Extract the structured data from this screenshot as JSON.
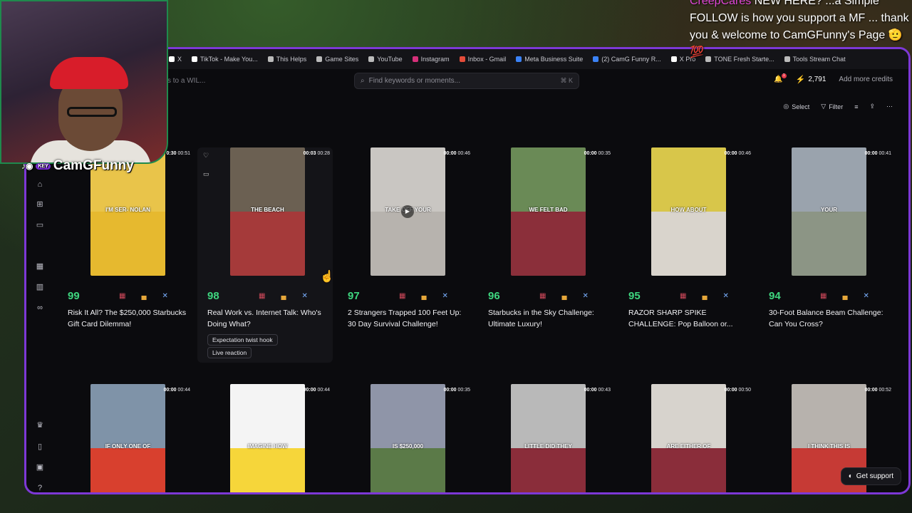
{
  "chat": {
    "username": "CreepCares",
    "message": "NEW HERE? ...a Simple FOLLOW is how you support a MF ... thank you & welcome to CamGFunny's Page 🫡💯"
  },
  "webcam": {
    "streamer_name": "CamGFunny",
    "badge": "KEY"
  },
  "bookmarks": [
    {
      "label": "X",
      "icon": "x-icon",
      "color": "#ffffff"
    },
    {
      "label": "TikTok - Make You...",
      "icon": "tiktok-icon",
      "color": "#ffffff"
    },
    {
      "label": "This Helps",
      "icon": "folder-icon",
      "color": "#bbbbbb"
    },
    {
      "label": "Game Sites",
      "icon": "folder-icon",
      "color": "#bbbbbb"
    },
    {
      "label": "YouTube",
      "icon": "folder-icon",
      "color": "#bbbbbb"
    },
    {
      "label": "Instagram",
      "icon": "instagram-icon",
      "color": "#d6307a"
    },
    {
      "label": "Inbox - Gmail",
      "icon": "gmail-icon",
      "color": "#e44c3a"
    },
    {
      "label": "Meta Business Suite",
      "icon": "meta-icon",
      "color": "#3b82f6"
    },
    {
      "label": "(2) CamG Funny R...",
      "icon": "facebook-icon",
      "color": "#3b82f6"
    },
    {
      "label": "X Pro",
      "icon": "x-icon",
      "color": "#ffffff"
    },
    {
      "label": "TONE Fresh Starte...",
      "icon": "page-icon",
      "color": "#bbbbbb"
    },
    {
      "label": "Tools Stream Chat",
      "icon": "folder-icon",
      "color": "#bbbbbb"
    }
  ],
  "topbar": {
    "crumb": "s to a WIL...",
    "search_placeholder": "Find keywords or moments...",
    "search_shortcut": "⌘ K",
    "notification_count": "1",
    "credits": "2,791",
    "add_credits": "Add more credits"
  },
  "toolbar": {
    "select": "Select",
    "filter": "Filter"
  },
  "clips_row1": [
    {
      "score": "99",
      "title": "Risk It All? The $250,000 Starbucks Gift Card Dilemma!",
      "time_start": "0:30",
      "time_end": "00:51",
      "caption": "I'M SER- NOLAN",
      "top": "#e9c44a",
      "bottom": "#e6b92f"
    },
    {
      "score": "98",
      "title": "Real Work vs. Internet Talk: Who's Doing What?",
      "time_start": "00:03",
      "time_end": "00:28",
      "caption": "THE BEACH",
      "top": "#6b6052",
      "bottom": "#a53a3a",
      "tags": [
        "Expectation twist hook",
        "Live reaction"
      ]
    },
    {
      "score": "97",
      "title": "2 Strangers Trapped 100 Feet Up: 30 Day Survival Challenge!",
      "time_start": "00:00",
      "time_end": "00:46",
      "caption": "TAKE OFF YOUR",
      "top": "#c9c6c2",
      "bottom": "#b7b3ae"
    },
    {
      "score": "96",
      "title": "Starbucks in the Sky Challenge: Ultimate Luxury!",
      "time_start": "00:00",
      "time_end": "00:35",
      "caption": "WE FELT BAD",
      "top": "#6a8a56",
      "bottom": "#8b2f3a"
    },
    {
      "score": "95",
      "title": "RAZOR SHARP SPIKE CHALLENGE: Pop Balloon or...",
      "time_start": "00:00",
      "time_end": "00:46",
      "caption": "HOW ABOUT",
      "top": "#d8c64a",
      "bottom": "#d9d4cc"
    },
    {
      "score": "94",
      "title": "30-Foot Balance Beam Challenge: Can You Cross?",
      "time_start": "00:00",
      "time_end": "00:41",
      "caption": "YOUR",
      "top": "#9aa3ad",
      "bottom": "#8c9585"
    }
  ],
  "clips_row2": [
    {
      "time_start": "00:00",
      "time_end": "00:44",
      "caption": "IF ONLY ONE OF",
      "top": "#7f93a8",
      "bottom": "#d8402e"
    },
    {
      "time_start": "00:00",
      "time_end": "00:44",
      "caption": "IMAGINE HOW",
      "top": "#f4f4f4",
      "bottom": "#f6d63a"
    },
    {
      "time_start": "00:00",
      "time_end": "00:35",
      "caption": "IS $250,000",
      "top": "#8f95a8",
      "bottom": "#5b7a48"
    },
    {
      "time_start": "00:00",
      "time_end": "00:43",
      "caption": "LITTLE DID THEY",
      "top": "#b9b9b9",
      "bottom": "#8a2d3a"
    },
    {
      "time_start": "00:00",
      "time_end": "00:50",
      "caption": "ARE EITHER OF",
      "top": "#d7d3cd",
      "bottom": "#8a2d3a"
    },
    {
      "time_start": "00:00",
      "time_end": "00:52",
      "caption": "I THINK THIS IS",
      "top": "#b7b2ad",
      "bottom": "#c63a35"
    }
  ],
  "support": {
    "label": "Get support"
  },
  "colors": {
    "accent": "#7d38d6",
    "score": "#3ed67f"
  }
}
